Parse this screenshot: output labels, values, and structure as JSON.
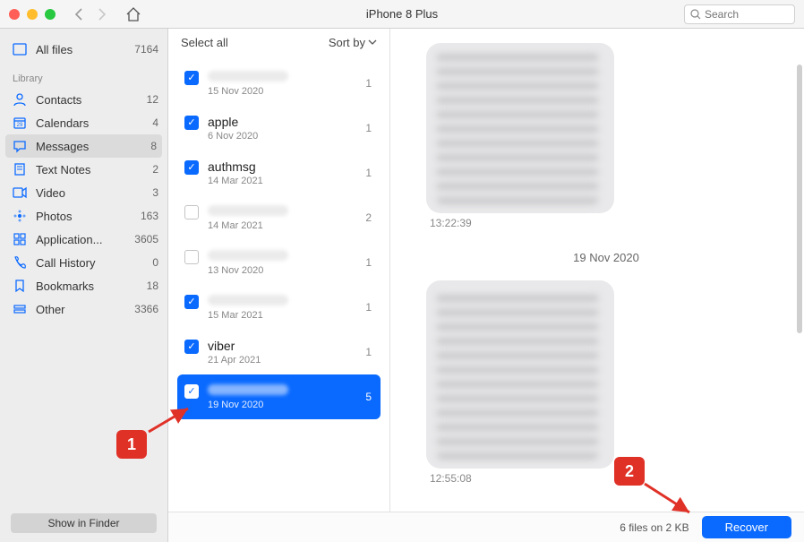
{
  "toolbar": {
    "title": "iPhone 8 Plus",
    "search_placeholder": "Search"
  },
  "sidebar": {
    "all_files": {
      "label": "All files",
      "count": "7164"
    },
    "library_header": "Library",
    "items": [
      {
        "icon": "contacts-icon",
        "label": "Contacts",
        "count": "12"
      },
      {
        "icon": "calendar-icon",
        "label": "Calendars",
        "count": "4"
      },
      {
        "icon": "messages-icon",
        "label": "Messages",
        "count": "8",
        "selected": true
      },
      {
        "icon": "notes-icon",
        "label": "Text Notes",
        "count": "2"
      },
      {
        "icon": "video-icon",
        "label": "Video",
        "count": "3"
      },
      {
        "icon": "photos-icon",
        "label": "Photos",
        "count": "163"
      },
      {
        "icon": "apps-icon",
        "label": "Application...",
        "count": "3605"
      },
      {
        "icon": "calls-icon",
        "label": "Call History",
        "count": "0"
      },
      {
        "icon": "bookmarks-icon",
        "label": "Bookmarks",
        "count": "18"
      },
      {
        "icon": "other-icon",
        "label": "Other",
        "count": "3366"
      }
    ],
    "show_in_finder": "Show in Finder"
  },
  "mid": {
    "select_all": "Select all",
    "sort_by": "Sort by",
    "conversations": [
      {
        "name": "",
        "blurred": true,
        "checked": true,
        "date": "15 Nov 2020",
        "count": "1"
      },
      {
        "name": "apple",
        "blurred": false,
        "checked": true,
        "date": "6 Nov 2020",
        "count": "1"
      },
      {
        "name": "authmsg",
        "blurred": false,
        "checked": true,
        "date": "14 Mar 2021",
        "count": "1"
      },
      {
        "name": "",
        "blurred": true,
        "checked": false,
        "date": "14 Mar 2021",
        "count": "2"
      },
      {
        "name": "",
        "blurred": true,
        "checked": false,
        "date": "13 Nov 2020",
        "count": "1"
      },
      {
        "name": "",
        "blurred": true,
        "checked": true,
        "date": "15 Mar 2021",
        "count": "1"
      },
      {
        "name": "viber",
        "blurred": false,
        "checked": true,
        "date": "21 Apr 2021",
        "count": "1"
      },
      {
        "name": "",
        "blurred": true,
        "checked": true,
        "date": "19 Nov 2020",
        "count": "5",
        "selected": true
      }
    ]
  },
  "content": {
    "msg1_time": "13:22:39",
    "day_sep": "19 Nov 2020",
    "msg2_time": "12:55:08"
  },
  "bottom": {
    "status": "6 files on 2 KB",
    "recover": "Recover"
  },
  "callouts": {
    "one": "1",
    "two": "2"
  }
}
